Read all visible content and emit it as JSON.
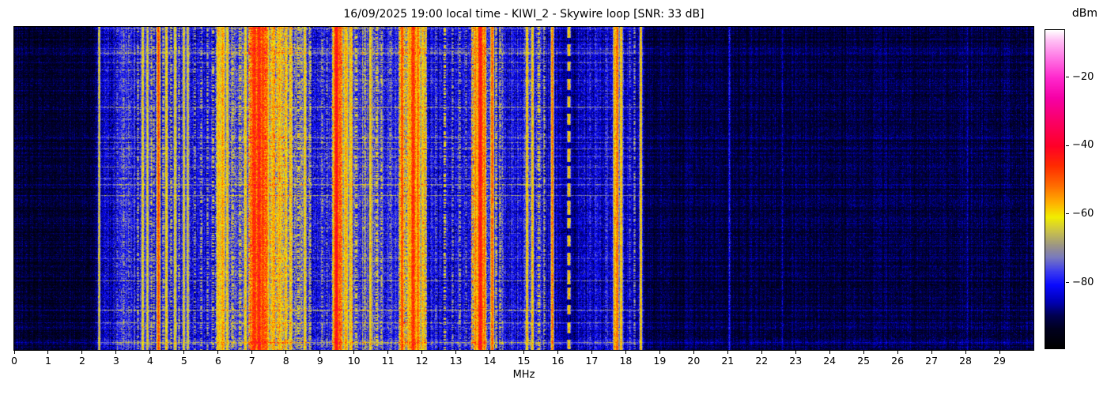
{
  "chart_data": {
    "type": "heatmap",
    "subtype": "spectrogram-waterfall",
    "title": "16/09/2025 19:00 local time - KIWI_2 - Skywire loop [SNR: 33 dB]",
    "xlabel": "MHz",
    "x_range": [
      0,
      30
    ],
    "xtick_values": [
      0,
      1,
      2,
      3,
      4,
      5,
      6,
      7,
      8,
      9,
      10,
      11,
      12,
      13,
      14,
      15,
      16,
      17,
      18,
      19,
      20,
      21,
      22,
      23,
      24,
      25,
      26,
      27,
      28,
      29
    ],
    "xtick_labels": [
      "0",
      "1",
      "2",
      "3",
      "4",
      "5",
      "6",
      "7",
      "8",
      "9",
      "10",
      "11",
      "12",
      "13",
      "14",
      "15",
      "16",
      "17",
      "18",
      "19",
      "20",
      "21",
      "22",
      "23",
      "24",
      "25",
      "26",
      "27",
      "28",
      "29"
    ],
    "grid": false,
    "colorbar": {
      "label": "dBm",
      "vmin": -99.5,
      "vmax": -6,
      "tick_values": [
        -20,
        -40,
        -60,
        -80
      ],
      "tick_labels": [
        "−20",
        "−40",
        "−60",
        "−80"
      ],
      "colormap_stops": [
        [
          -99.5,
          "#000000"
        ],
        [
          -94.0,
          "#00001e"
        ],
        [
          -90.0,
          "#000050"
        ],
        [
          -86.0,
          "#0000b4"
        ],
        [
          -81.0,
          "#0a0aff"
        ],
        [
          -77.0,
          "#3c3cf0"
        ],
        [
          -73.0,
          "#7878c0"
        ],
        [
          -69.0,
          "#a09a80"
        ],
        [
          -65.0,
          "#ccc448"
        ],
        [
          -61.0,
          "#f2ee00"
        ],
        [
          -57.0,
          "#ffb400"
        ],
        [
          -52.0,
          "#ff7000"
        ],
        [
          -46.0,
          "#ff2d00"
        ],
        [
          -40.0,
          "#ff0028"
        ],
        [
          -33.0,
          "#fb0064"
        ],
        [
          -26.0,
          "#f600a6"
        ],
        [
          -20.0,
          "#ff28cd"
        ],
        [
          -14.0,
          "#ff78e6"
        ],
        [
          -9.0,
          "#ffc0f5"
        ],
        [
          -6.0,
          "#ffffff"
        ]
      ]
    },
    "noise_floor_segments": [
      [
        0.0,
        2.4,
        -92,
        2.8
      ],
      [
        2.4,
        2.62,
        -87,
        4.0
      ],
      [
        2.62,
        3.1,
        -84,
        5.0
      ],
      [
        3.1,
        3.6,
        -79,
        5.5
      ],
      [
        3.6,
        5.3,
        -80,
        6.0
      ],
      [
        5.3,
        5.9,
        -82,
        5.0
      ],
      [
        5.9,
        6.4,
        -73,
        8.0
      ],
      [
        6.4,
        6.9,
        -77,
        7.0
      ],
      [
        6.9,
        7.45,
        -58,
        10.0
      ],
      [
        7.45,
        8.2,
        -66,
        9.0
      ],
      [
        8.2,
        8.75,
        -74,
        8.0
      ],
      [
        8.75,
        9.35,
        -80,
        5.5
      ],
      [
        9.35,
        9.65,
        -61,
        10.0
      ],
      [
        9.65,
        9.95,
        -69,
        8.0
      ],
      [
        9.95,
        10.25,
        -78,
        6.0
      ],
      [
        10.25,
        10.85,
        -74,
        7.0
      ],
      [
        10.85,
        11.3,
        -80,
        5.5
      ],
      [
        11.3,
        12.15,
        -67,
        9.0
      ],
      [
        12.15,
        13.45,
        -82,
        5.0
      ],
      [
        13.45,
        13.9,
        -64,
        10.0
      ],
      [
        13.9,
        14.4,
        -77,
        7.0
      ],
      [
        14.4,
        15.0,
        -82,
        5.0
      ],
      [
        15.0,
        15.6,
        -78,
        6.5
      ],
      [
        15.6,
        16.1,
        -84,
        4.5
      ],
      [
        16.1,
        16.6,
        -87,
        3.5
      ],
      [
        16.6,
        17.5,
        -84,
        4.5
      ],
      [
        17.5,
        18.0,
        -83,
        5.0
      ],
      [
        18.0,
        18.55,
        -85,
        4.0
      ],
      [
        18.55,
        30.0,
        -91,
        2.8
      ]
    ],
    "carriers": [
      [
        2.5,
        0.02,
        -62,
        "s"
      ],
      [
        3.02,
        0.02,
        -72,
        "f"
      ],
      [
        3.22,
        0.02,
        -68,
        "f"
      ],
      [
        3.38,
        0.02,
        -70,
        "f"
      ],
      [
        3.62,
        0.02,
        -66,
        "f"
      ],
      [
        3.76,
        0.03,
        -61,
        "s"
      ],
      [
        3.91,
        0.03,
        -62,
        "s"
      ],
      [
        4.02,
        0.02,
        -64,
        "f"
      ],
      [
        4.1,
        0.02,
        -66,
        "f"
      ],
      [
        4.24,
        0.03,
        -48,
        "s"
      ],
      [
        4.37,
        0.02,
        -63,
        "f"
      ],
      [
        4.47,
        0.03,
        -59,
        "s"
      ],
      [
        4.6,
        0.02,
        -64,
        "f"
      ],
      [
        4.72,
        0.03,
        -61,
        "s"
      ],
      [
        4.85,
        0.02,
        -65,
        "f"
      ],
      [
        4.98,
        0.03,
        -62,
        "s"
      ],
      [
        5.1,
        0.03,
        -63,
        "s"
      ],
      [
        5.3,
        0.02,
        -67,
        "f"
      ],
      [
        5.5,
        0.02,
        -65,
        "f"
      ],
      [
        5.68,
        0.02,
        -66,
        "f"
      ],
      [
        5.85,
        0.03,
        -63,
        "f"
      ],
      [
        6.0,
        0.04,
        -57,
        "s"
      ],
      [
        6.12,
        0.04,
        -55,
        "s"
      ],
      [
        6.25,
        0.03,
        -60,
        "s"
      ],
      [
        6.42,
        0.03,
        -63,
        "f"
      ],
      [
        6.63,
        0.03,
        -61,
        "f"
      ],
      [
        6.8,
        0.03,
        -59,
        "s"
      ],
      [
        7.05,
        0.06,
        -45,
        "s"
      ],
      [
        7.18,
        0.05,
        -44,
        "s"
      ],
      [
        7.3,
        0.05,
        -47,
        "s"
      ],
      [
        7.43,
        0.04,
        -52,
        "s"
      ],
      [
        7.62,
        0.04,
        -56,
        "s"
      ],
      [
        7.8,
        0.04,
        -57,
        "s"
      ],
      [
        7.98,
        0.03,
        -58,
        "s"
      ],
      [
        8.12,
        0.03,
        -60,
        "s"
      ],
      [
        8.35,
        0.03,
        -61,
        "f"
      ],
      [
        8.55,
        0.03,
        -59,
        "s"
      ],
      [
        8.7,
        0.02,
        -63,
        "f"
      ],
      [
        9.05,
        0.02,
        -67,
        "f"
      ],
      [
        9.2,
        0.02,
        -69,
        "f"
      ],
      [
        9.48,
        0.05,
        -42,
        "s"
      ],
      [
        9.6,
        0.04,
        -50,
        "s"
      ],
      [
        9.75,
        0.04,
        -56,
        "s"
      ],
      [
        9.88,
        0.03,
        -58,
        "s"
      ],
      [
        10.05,
        0.03,
        -62,
        "f"
      ],
      [
        10.3,
        0.02,
        -66,
        "f"
      ],
      [
        10.48,
        0.03,
        -59,
        "s"
      ],
      [
        10.65,
        0.03,
        -61,
        "f"
      ],
      [
        10.8,
        0.02,
        -64,
        "f"
      ],
      [
        11.05,
        0.02,
        -68,
        "f"
      ],
      [
        11.4,
        0.03,
        -47,
        "s"
      ],
      [
        11.62,
        0.03,
        -55,
        "s"
      ],
      [
        11.74,
        0.05,
        -45,
        "s"
      ],
      [
        11.88,
        0.04,
        -51,
        "s"
      ],
      [
        12.0,
        0.03,
        -57,
        "s"
      ],
      [
        12.1,
        0.02,
        -61,
        "f"
      ],
      [
        12.4,
        0.02,
        -70,
        "f"
      ],
      [
        12.65,
        0.025,
        -59,
        "f"
      ],
      [
        12.9,
        0.02,
        -68,
        "f"
      ],
      [
        13.1,
        0.02,
        -66,
        "f"
      ],
      [
        13.3,
        0.02,
        -69,
        "f"
      ],
      [
        13.57,
        0.03,
        -52,
        "s"
      ],
      [
        13.7,
        0.05,
        -42,
        "s"
      ],
      [
        13.83,
        0.03,
        -51,
        "s"
      ],
      [
        14.05,
        0.03,
        -49,
        "s"
      ],
      [
        14.18,
        0.02,
        -62,
        "f"
      ],
      [
        14.3,
        0.02,
        -65,
        "f"
      ],
      [
        15.08,
        0.025,
        -57,
        "s"
      ],
      [
        15.24,
        0.025,
        -57,
        "s"
      ],
      [
        15.43,
        0.03,
        -60,
        "f"
      ],
      [
        15.6,
        0.02,
        -66,
        "f"
      ],
      [
        15.82,
        0.025,
        -51,
        "s"
      ],
      [
        16.32,
        0.03,
        -57,
        "d"
      ],
      [
        16.95,
        0.02,
        -75,
        "f"
      ],
      [
        17.1,
        0.02,
        -75,
        "f"
      ],
      [
        17.4,
        0.02,
        -72,
        "f"
      ],
      [
        17.66,
        0.03,
        -55,
        "s"
      ],
      [
        17.74,
        0.025,
        -49,
        "s"
      ],
      [
        17.84,
        0.03,
        -57,
        "s"
      ],
      [
        18.1,
        0.02,
        -71,
        "f"
      ],
      [
        18.25,
        0.02,
        -68,
        "f"
      ],
      [
        18.43,
        0.025,
        -57,
        "s"
      ],
      [
        21.05,
        0.02,
        -79,
        "s"
      ],
      [
        22.6,
        0.015,
        -85,
        "s"
      ],
      [
        28.05,
        0.015,
        -85,
        "s"
      ]
    ],
    "texture": {
      "seed": 1337,
      "row_jitter": 1.2,
      "column_jitter_factor": 0.5,
      "striation_count": 26,
      "striation_boost": [
        5,
        13
      ],
      "active_floor_threshold": -88,
      "quiet_striation_factor": 0.35
    }
  }
}
